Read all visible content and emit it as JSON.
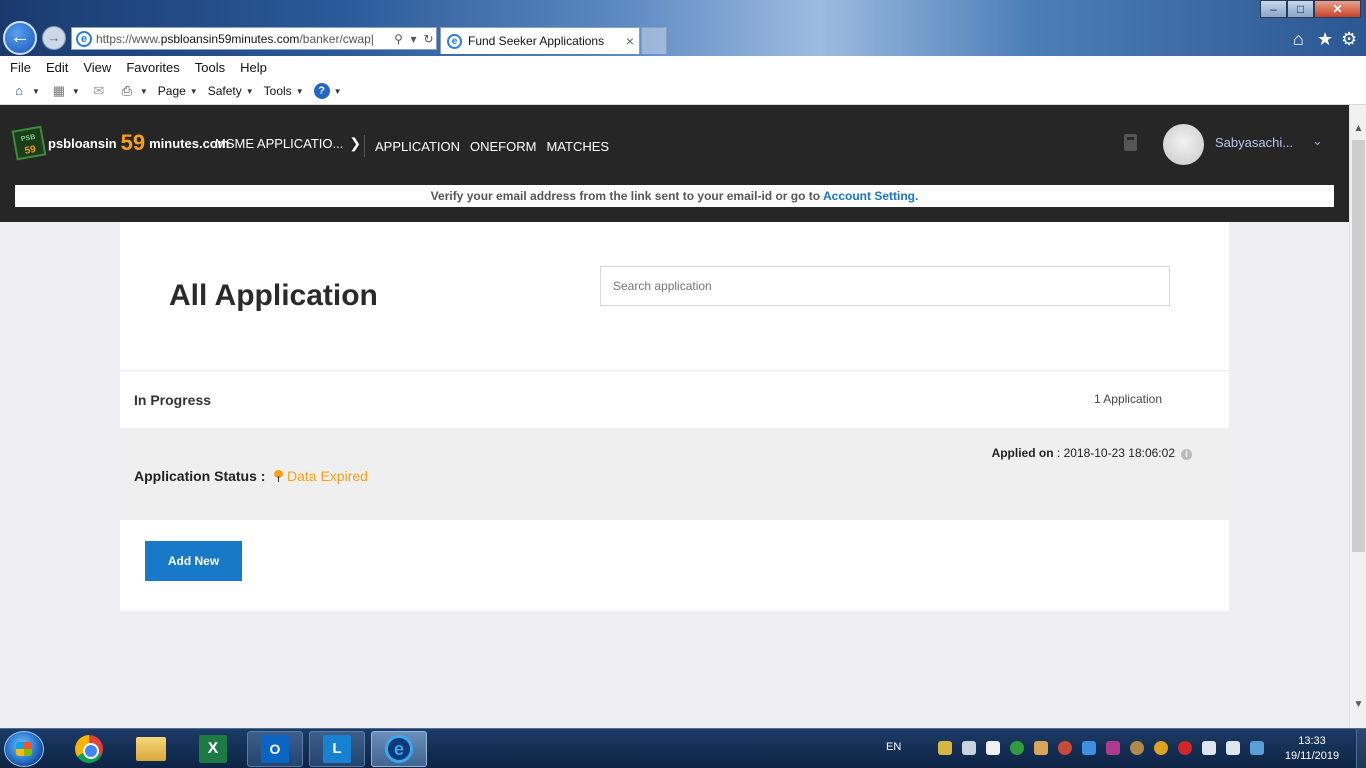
{
  "browser": {
    "url_prefix": "https://www.",
    "url_domain": "psbloansin59minutes.com",
    "url_path": "/banker/cwap|",
    "tab_title": "Fund Seeker Applications",
    "tab_close": "×",
    "menu": [
      "File",
      "Edit",
      "View",
      "Favorites",
      "Tools",
      "Help"
    ],
    "command_bar": {
      "page": "Page",
      "safety": "Safety",
      "tools": "Tools"
    }
  },
  "site": {
    "logo": {
      "badge_psb": "PSB",
      "badge_59": "59",
      "text_left": "psbloansin",
      "text_59": "59",
      "text_right": "minutes.com"
    },
    "msme_menu": "MSME APPLICATIO...",
    "nav": [
      "APPLICATION",
      "ONEFORM",
      "MATCHES"
    ],
    "username": "Sabyasachi...",
    "verify_text": "Verify your email address from the link sent to your email-id or go to ",
    "verify_link": "Account Setting."
  },
  "page": {
    "title": "All Application",
    "search_placeholder": "Search application",
    "section_label": "In Progress",
    "section_count": "1 Application",
    "application": {
      "applied_on_label": "Applied on",
      "applied_on_value": " : 2018-10-23 18:06:02",
      "status_label": "Application Status :",
      "status_value": "Data Expired"
    },
    "add_new_label": "Add New"
  },
  "taskbar": {
    "language": "EN",
    "time": "13:33",
    "date": "19/11/2019"
  },
  "colors": {
    "header_bg": "#262626",
    "accent_orange": "#f7a11a",
    "link_blue": "#1a73c9",
    "button_blue": "#1779c8"
  }
}
